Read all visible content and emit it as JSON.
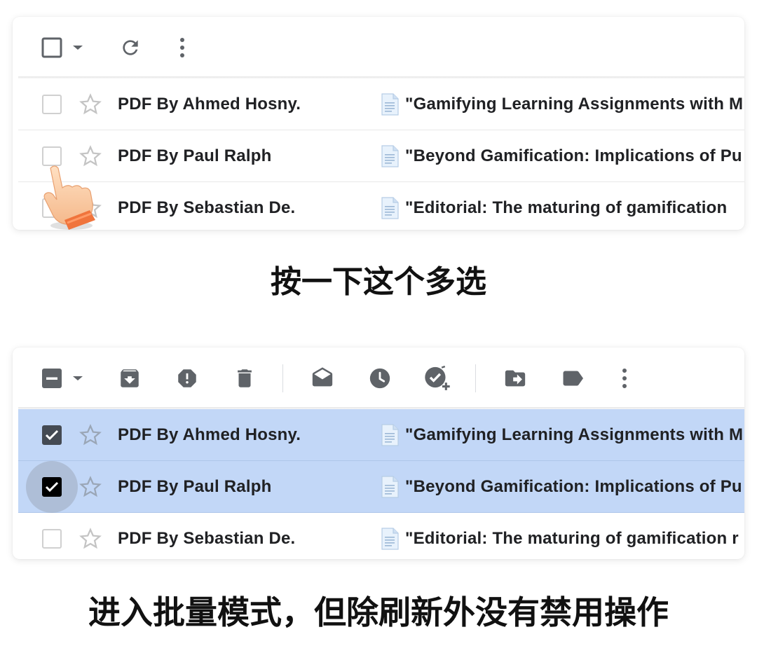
{
  "colors": {
    "icon_gray": "#5f6368",
    "selected_row": "#c2d7f7",
    "text": "#202124",
    "checkbox_border": "#d0d0d0"
  },
  "panel_top": {
    "toolbar": {
      "select_all_icon": "checkbox-empty-icon",
      "dropdown_icon": "caret-down-icon",
      "refresh_icon": "refresh-icon",
      "more_icon": "more-vertical-icon"
    },
    "rows": [
      {
        "sender": "PDF By Ahmed Hosny.",
        "subject": "\"Gamifying Learning Assignments with M",
        "checked": false
      },
      {
        "sender": "PDF By Paul Ralph",
        "subject": "\"Beyond Gamification: Implications of Pu",
        "checked": false
      },
      {
        "sender": "PDF By Sebastian De.",
        "subject": "\"Editorial: The maturing of gamification",
        "checked": false
      }
    ]
  },
  "caption_top": "按一下这个多选",
  "panel_bottom": {
    "toolbar": {
      "select_all_icon": "checkbox-indeterminate-icon",
      "icons": [
        "archive-icon",
        "report-spam-icon",
        "delete-icon",
        "mark-read-icon",
        "snooze-icon",
        "add-task-icon",
        "move-to-icon",
        "label-icon",
        "more-vertical-icon"
      ]
    },
    "rows": [
      {
        "sender": "PDF By Ahmed Hosny.",
        "subject": "\"Gamifying Learning Assignments with M",
        "checked": true
      },
      {
        "sender": "PDF By Paul Ralph",
        "subject": "\"Beyond Gamification: Implications of Pu",
        "checked": true
      },
      {
        "sender": "PDF By Sebastian De.",
        "subject": "\"Editorial: The maturing of gamification r",
        "checked": false
      }
    ]
  },
  "caption_bottom": "进入批量模式，但除刷新外没有禁用操作"
}
